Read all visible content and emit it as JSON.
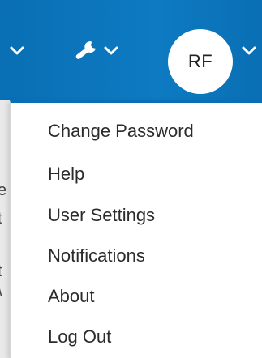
{
  "header": {
    "avatar_initials": "RF",
    "icons": {
      "left_chevron": "chevron-down-icon",
      "tools": "wrench-icon",
      "tools_chevron": "chevron-down-icon",
      "user_chevron": "chevron-down-icon"
    },
    "colors": {
      "header_bg": "#0a6fb4",
      "avatar_bg": "#ffffff",
      "menu_bg": "#ffffff"
    }
  },
  "menu": {
    "items": [
      {
        "label": "Change Password"
      },
      {
        "label": "Help"
      },
      {
        "label": "User Settings"
      },
      {
        "label": "Notifications"
      },
      {
        "label": "About"
      },
      {
        "label": "Log Out"
      }
    ]
  },
  "background_page": {
    "partial_chars": [
      "e",
      "t",
      "t",
      "\\"
    ]
  }
}
